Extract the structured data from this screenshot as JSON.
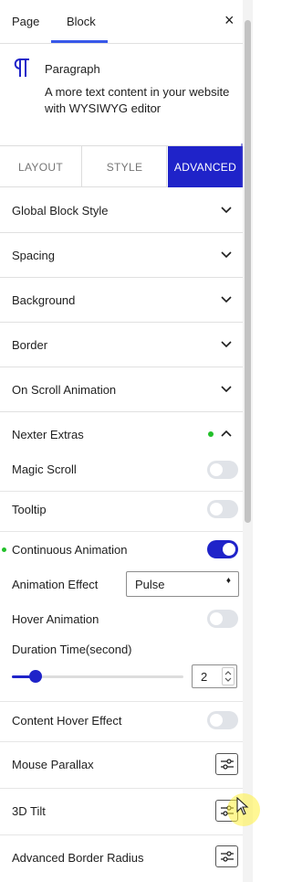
{
  "top_tabs": {
    "page": "Page",
    "block": "Block",
    "close": "×"
  },
  "block_card": {
    "name": "Paragraph",
    "description": "A more text content in your website with WYSIWYG editor"
  },
  "sub_tabs": {
    "layout": "LAYOUT",
    "style": "STYLE",
    "advanced": "ADVANCED"
  },
  "accordions": {
    "global_block_style": "Global Block Style",
    "spacing": "Spacing",
    "background": "Background",
    "border": "Border",
    "on_scroll_animation": "On Scroll Animation",
    "nexter_extras": "Nexter Extras"
  },
  "nexter": {
    "magic_scroll": {
      "label": "Magic Scroll",
      "enabled": false
    },
    "tooltip": {
      "label": "Tooltip",
      "enabled": false
    },
    "continuous_animation": {
      "label": "Continuous Animation",
      "enabled": true
    },
    "animation_effect": {
      "label": "Animation Effect",
      "value": "Pulse",
      "caret": "♦"
    },
    "hover_animation": {
      "label": "Hover Animation",
      "enabled": false
    },
    "duration_time": {
      "label": "Duration Time(second)",
      "value": "2",
      "fill_fraction": 0.14
    },
    "content_hover_effect": {
      "label": "Content Hover Effect",
      "enabled": false
    },
    "mouse_parallax": {
      "label": "Mouse Parallax"
    },
    "tilt_3d": {
      "label": "3D Tilt"
    },
    "advanced_border_radius": {
      "label": "Advanced Border Radius"
    }
  },
  "colors": {
    "accent": "#1f23c9",
    "tab_underline": "#3858e9",
    "indicator_dot": "#22c02a"
  },
  "icons": {
    "paragraph": "paragraph-icon",
    "chevron": "chevron-down-icon",
    "chevron_up": "chevron-up-icon",
    "settings": "sliders-icon"
  }
}
